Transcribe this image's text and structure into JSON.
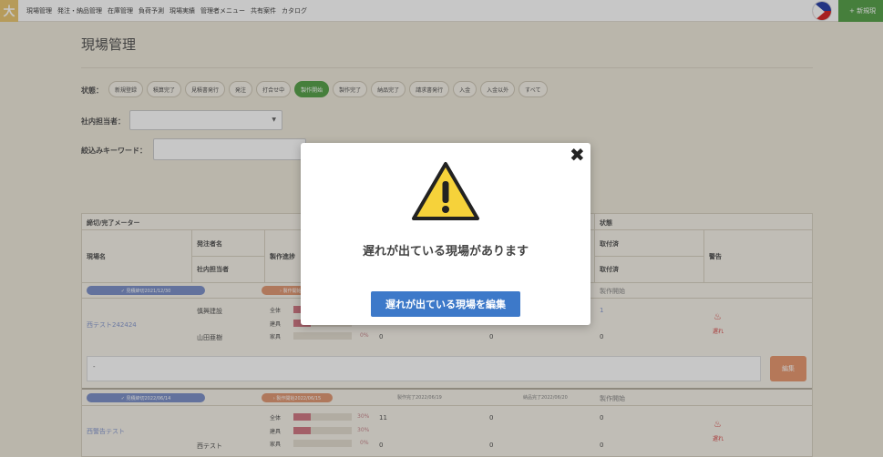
{
  "nav": {
    "logo": "大",
    "items": [
      "現場管理",
      "発注・納品管理",
      "在庫管理",
      "負荷予測",
      "現場実績",
      "管理者メニュー",
      "共有案件",
      "カタログ"
    ],
    "new_button": "+ 新規現"
  },
  "page": {
    "title": "現場管理"
  },
  "filters": {
    "status_label": "状態：",
    "statuses": [
      {
        "label": "新規登録",
        "active": false
      },
      {
        "label": "積算完了",
        "active": false
      },
      {
        "label": "見積書発行",
        "active": false
      },
      {
        "label": "発注",
        "active": false
      },
      {
        "label": "打合せ中",
        "active": false
      },
      {
        "label": "製作開始",
        "active": true
      },
      {
        "label": "製作完了",
        "active": false
      },
      {
        "label": "納品完了",
        "active": false
      },
      {
        "label": "請求書発行",
        "active": false
      },
      {
        "label": "入金",
        "active": false
      },
      {
        "label": "入金以外",
        "active": false
      },
      {
        "label": "すべて",
        "active": false
      }
    ],
    "staff_label": "社内担当者：",
    "staff_value": "",
    "keyword_label": "絞込みキーワード：",
    "keyword_value": ""
  },
  "table": {
    "headers": {
      "meter": "締切/完了メーター",
      "site": "現場名",
      "orderer": "発注者名",
      "staff": "社内担当者",
      "progress": "製作進捗",
      "status": "状態",
      "installed1": "取付済",
      "installed2": "取付済",
      "warning": "警告"
    },
    "rows": [
      {
        "pill1": "✓ 見積締切2021/12/30",
        "pill2": "› 製作開始20",
        "status": "製作開始",
        "site": "西テスト242424",
        "orderer": "慎興建設",
        "staff": "山田亜樹",
        "prog_labels": [
          "全体",
          "建具",
          "家具"
        ],
        "prog_values": [
          30,
          30,
          0
        ],
        "pct_last": "0%",
        "col_a": [
          "",
          "",
          "0"
        ],
        "col_b": [
          "",
          "",
          "0"
        ],
        "col_c": [
          "1",
          "",
          "0"
        ],
        "warn_icon": "♨",
        "warn_text": "遅れ",
        "memo": "-",
        "edit": "編集"
      },
      {
        "pill1": "✓ 見積締切2022/06/14",
        "pill2": "› 製作開始2022/06/15",
        "pill3": "製作完了2022/06/19",
        "pill4": "納品完了2022/06/20",
        "status": "製作開始",
        "site": "西警告テスト",
        "orderer": "",
        "staff": "西テスト",
        "prog_labels": [
          "全体",
          "建具",
          "家具"
        ],
        "prog_values": [
          30,
          30,
          0
        ],
        "pct": [
          "30%",
          "30%",
          "0%"
        ],
        "col_a": [
          "11",
          "",
          "0"
        ],
        "col_b": [
          "0",
          "",
          "0"
        ],
        "col_c": [
          "0",
          "",
          "0"
        ],
        "warn_icon": "♨",
        "warn_text": "遅れ"
      }
    ]
  },
  "modal": {
    "icon": "warning-triangle",
    "close": "✖",
    "message": "遅れが出ている現場があります",
    "button": "遅れが出ている現場を編集"
  }
}
